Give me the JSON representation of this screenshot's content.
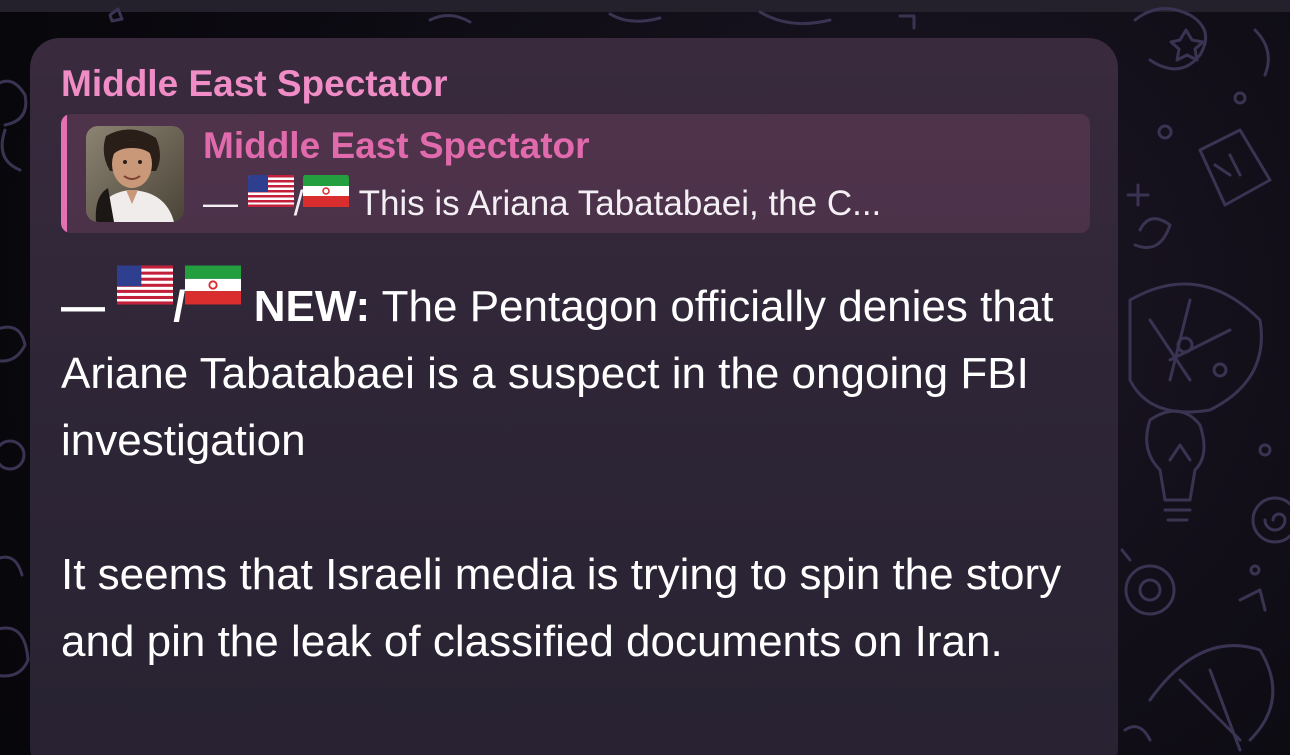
{
  "post": {
    "sender_name": "Middle East Spectator",
    "reply": {
      "author": "Middle East Spectator",
      "dash": "—",
      "flag_separator": "/",
      "text": "This is Ariana Tabatabaei, the C..."
    },
    "message": {
      "dash": "—",
      "flag_separator": "/",
      "tag": "NEW:",
      "paragraph_1": "The Pentagon officially denies that Ariane Tabatabaei is a suspect in the ongoing FBI investigation",
      "paragraph_2": "It seems that Israeli media is trying to spin the story and pin the leak of classified documents on Iran."
    },
    "icons": [
      "us-flag-icon",
      "iran-flag-icon"
    ]
  },
  "colors": {
    "sender_name": "#f08cc6",
    "reply_author": "#e06aac",
    "reply_bar": "#e272b3",
    "message_text": "#ffffff",
    "bubble": "#2e2637"
  }
}
